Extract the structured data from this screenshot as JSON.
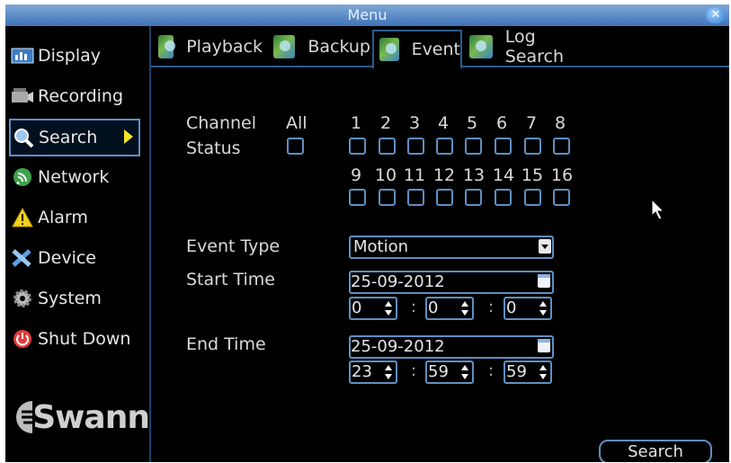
{
  "window": {
    "title": "Menu"
  },
  "sidebar": {
    "items": [
      {
        "label": "Display",
        "icon": "display-icon"
      },
      {
        "label": "Recording",
        "icon": "recording-icon"
      },
      {
        "label": "Search",
        "icon": "search-icon",
        "selected": true
      },
      {
        "label": "Network",
        "icon": "network-icon"
      },
      {
        "label": "Alarm",
        "icon": "alarm-icon"
      },
      {
        "label": "Device",
        "icon": "device-icon"
      },
      {
        "label": "System",
        "icon": "system-icon"
      },
      {
        "label": "Shut Down",
        "icon": "shutdown-icon"
      }
    ],
    "logo_text": "Swann"
  },
  "tabs": [
    {
      "label": "Playback"
    },
    {
      "label": "Backup"
    },
    {
      "label": "Event",
      "active": true
    },
    {
      "label": "Log Search"
    }
  ],
  "form": {
    "channel_label": "Channel",
    "status_label": "Status",
    "all_label": "All",
    "channels_row1": [
      "1",
      "2",
      "3",
      "4",
      "5",
      "6",
      "7",
      "8"
    ],
    "channels_row2": [
      "9",
      "10",
      "11",
      "12",
      "13",
      "14",
      "15",
      "16"
    ],
    "event_type_label": "Event Type",
    "event_type_value": "Motion",
    "start_time_label": "Start Time",
    "start_date": "25-09-2012",
    "start_h": "0",
    "start_m": "0",
    "start_s": "0",
    "end_time_label": "End Time",
    "end_date": "25-09-2012",
    "end_h": "23",
    "end_m": "59",
    "end_s": "59",
    "time_separator": ":"
  },
  "actions": {
    "search_label": "Search"
  },
  "colors": {
    "accent_border": "#5f8fc1",
    "titlebar": "#3f73b8",
    "arrow": "#f3e52a"
  }
}
